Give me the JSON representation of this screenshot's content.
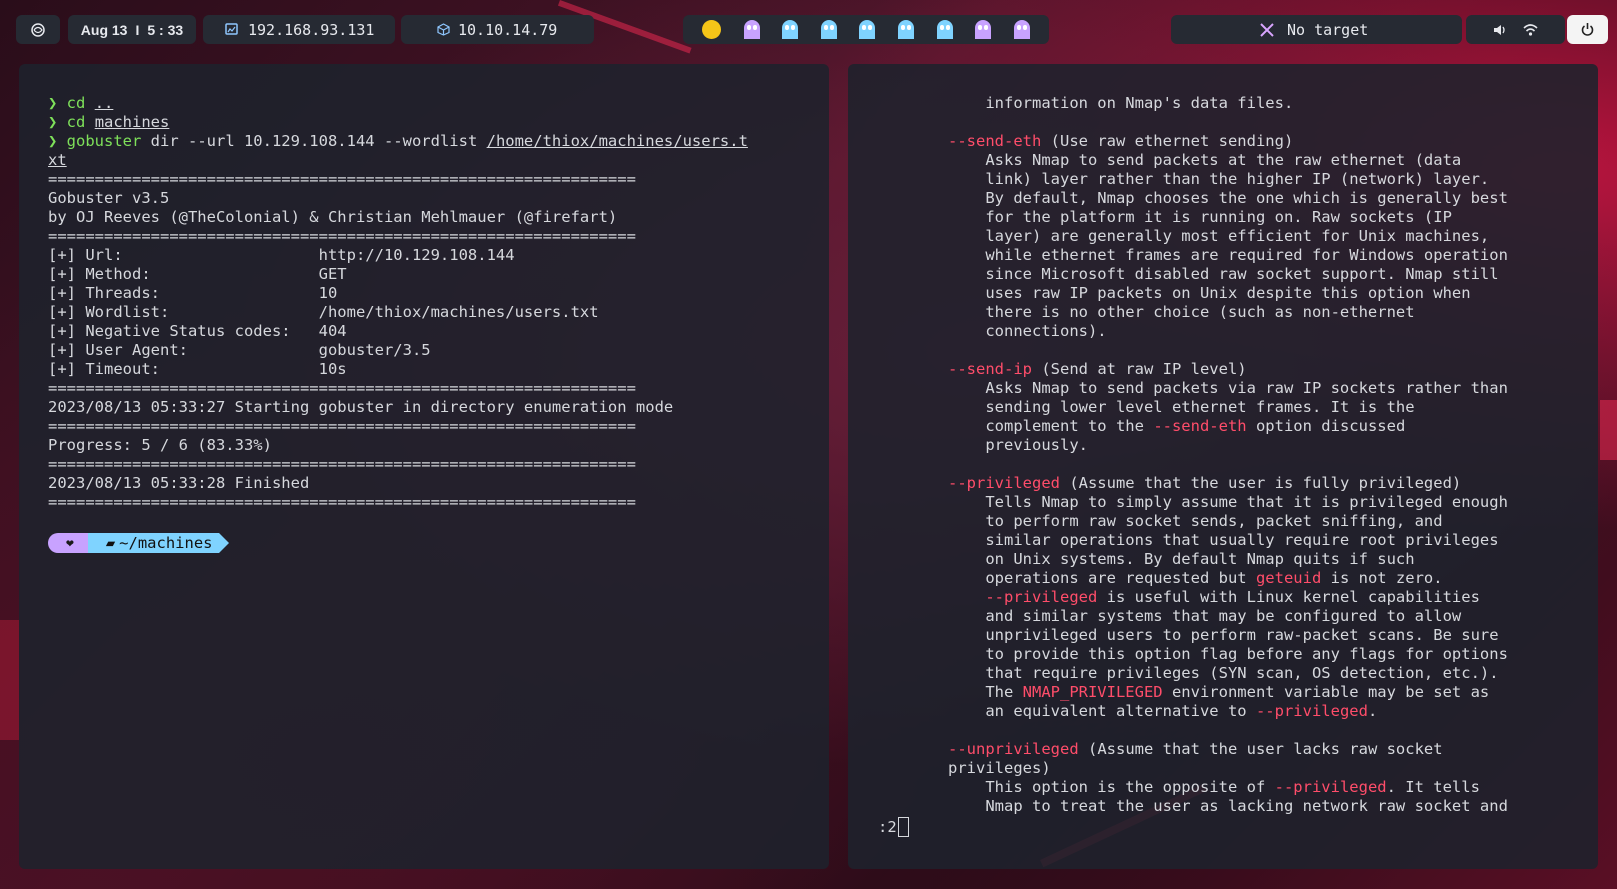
{
  "topbar": {
    "date": "Aug 13",
    "time": "5 : 33",
    "vpn_ip": "192.168.93.131",
    "target_ip": "10.10.14.79",
    "target_label": "No target",
    "workspaces": [
      "pacman",
      "ghost",
      "ghost",
      "ghost",
      "ghost",
      "ghost",
      "ghost",
      "ghost",
      "ghost"
    ],
    "colors": {
      "ghost_purple": "#c8a2ff",
      "ghost_blue": "#7fd3ff",
      "pacman": "#f5c518"
    }
  },
  "left_terminal": {
    "lines": [
      {
        "p": "❯ ",
        "c": "cd ",
        "a": ".."
      },
      {
        "p": "❯ ",
        "c": "cd ",
        "a": "machines"
      },
      {
        "p": "❯ ",
        "c": "gobuster dir --url 10.129.108.144 --wordlist ",
        "a": "/home/thiox/machines/users.t"
      },
      {
        "p": "",
        "c": "",
        "a": "xt"
      }
    ],
    "output": "===============================================================\nGobuster v3.5\nby OJ Reeves (@TheColonial) & Christian Mehlmauer (@firefart)\n===============================================================\n[+] Url:                     http://10.129.108.144\n[+] Method:                  GET\n[+] Threads:                 10\n[+] Wordlist:                /home/thiox/machines/users.txt\n[+] Negative Status codes:   404\n[+] User Agent:              gobuster/3.5\n[+] Timeout:                 10s\n===============================================================\n2023/08/13 05:33:27 Starting gobuster in directory enumeration mode\n===============================================================\nProgress: 5 / 6 (83.33%)\n===============================================================\n2023/08/13 05:33:28 Finished\n===============================================================",
    "prompt_heart": "❤",
    "prompt_dir": "~/machines"
  },
  "right_terminal": {
    "pager_prompt": ":2",
    "blocks": [
      [
        [
          "information on Nmap's data files.",
          ""
        ]
      ]
    ],
    "text": [
      [
        [
          "    information on Nmap's data files.",
          ""
        ]
      ],
      [
        [
          "",
          ""
        ]
      ],
      [
        [
          "--send-eth",
          "r"
        ],
        [
          " (Use raw ethernet sending)",
          ""
        ]
      ],
      [
        [
          "    Asks Nmap to send packets at the raw ethernet (data",
          ""
        ]
      ],
      [
        [
          "    link) layer rather than the higher IP (network) layer.",
          ""
        ]
      ],
      [
        [
          "    By default, Nmap chooses the one which is generally best",
          ""
        ]
      ],
      [
        [
          "    for the platform it is running on. Raw sockets (IP",
          ""
        ]
      ],
      [
        [
          "    layer) are generally most efficient for Unix machines,",
          ""
        ]
      ],
      [
        [
          "    while ethernet frames are required for Windows operation",
          ""
        ]
      ],
      [
        [
          "    since Microsoft disabled raw socket support. Nmap still",
          ""
        ]
      ],
      [
        [
          "    uses raw IP packets on Unix despite this option when",
          ""
        ]
      ],
      [
        [
          "    there is no other choice (such as non-ethernet",
          ""
        ]
      ],
      [
        [
          "    connections).",
          ""
        ]
      ],
      [
        [
          "",
          ""
        ]
      ],
      [
        [
          "--send-ip",
          "r"
        ],
        [
          " (Send at raw IP level)",
          ""
        ]
      ],
      [
        [
          "    Asks Nmap to send packets via raw IP sockets rather than",
          ""
        ]
      ],
      [
        [
          "    sending lower level ethernet frames. It is the",
          ""
        ]
      ],
      [
        [
          "    complement to the ",
          ""
        ],
        [
          "--send-eth",
          "r"
        ],
        [
          " option discussed",
          ""
        ]
      ],
      [
        [
          "    previously.",
          ""
        ]
      ],
      [
        [
          "",
          ""
        ]
      ],
      [
        [
          "--privileged",
          "r"
        ],
        [
          " (Assume that the user is fully privileged)",
          ""
        ]
      ],
      [
        [
          "    Tells Nmap to simply assume that it is privileged enough",
          ""
        ]
      ],
      [
        [
          "    to perform raw socket sends, packet sniffing, and",
          ""
        ]
      ],
      [
        [
          "    similar operations that usually require root privileges",
          ""
        ]
      ],
      [
        [
          "    on Unix systems. By default Nmap quits if such",
          ""
        ]
      ],
      [
        [
          "    operations are requested but ",
          ""
        ],
        [
          "geteuid",
          "r"
        ],
        [
          " is not zero.",
          ""
        ]
      ],
      [
        [
          "    ",
          ""
        ],
        [
          "--privileged",
          "r"
        ],
        [
          " is useful with Linux kernel capabilities",
          ""
        ]
      ],
      [
        [
          "    and similar systems that may be configured to allow",
          ""
        ]
      ],
      [
        [
          "    unprivileged users to perform raw-packet scans. Be sure",
          ""
        ]
      ],
      [
        [
          "    to provide this option flag before any flags for options",
          ""
        ]
      ],
      [
        [
          "    that require privileges (SYN scan, OS detection, etc.).",
          ""
        ]
      ],
      [
        [
          "    The ",
          ""
        ],
        [
          "NMAP_PRIVILEGED",
          "r"
        ],
        [
          " environment variable may be set as",
          ""
        ]
      ],
      [
        [
          "    an equivalent alternative to ",
          ""
        ],
        [
          "--privileged",
          "r"
        ],
        [
          ".",
          ""
        ]
      ],
      [
        [
          "",
          ""
        ]
      ],
      [
        [
          "--unprivileged",
          "r"
        ],
        [
          " (Assume that the user lacks raw socket",
          ""
        ]
      ],
      [
        [
          "privileges)",
          ""
        ]
      ],
      [
        [
          "    This option is the opposite of ",
          ""
        ],
        [
          "--privileged",
          "r"
        ],
        [
          ". It tells",
          ""
        ]
      ],
      [
        [
          "    Nmap to treat the user as lacking network raw socket and",
          ""
        ]
      ]
    ]
  }
}
